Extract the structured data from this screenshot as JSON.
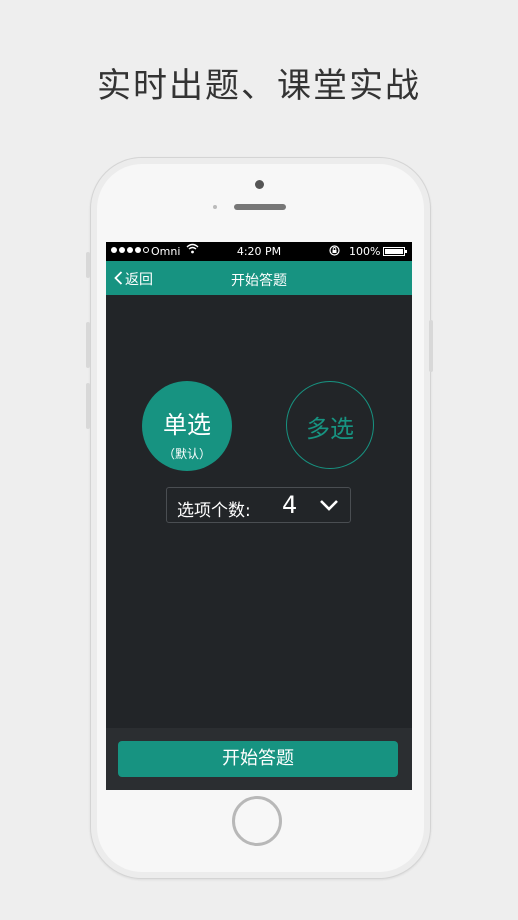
{
  "promo": {
    "headline": "实时出题、课堂实战"
  },
  "status_bar": {
    "carrier": "Omni",
    "time": "4:20 PM",
    "battery": "100%",
    "signal_icon": "signal-dots-icon",
    "wifi_icon": "wifi-icon",
    "lock_icon": "rotation-lock-icon",
    "battery_icon": "battery-icon"
  },
  "nav": {
    "back_label": "返回",
    "title": "开始答题",
    "color": "#179381"
  },
  "mode": {
    "single_label": "单选",
    "single_sub": "（默认）",
    "multi_label": "多选"
  },
  "options": {
    "label": "选项个数:",
    "value": "4"
  },
  "start_button": {
    "label": "开始答题"
  },
  "colors": {
    "accent": "#179381",
    "screen_bg": "#222528",
    "page_bg": "#eeeeee"
  }
}
